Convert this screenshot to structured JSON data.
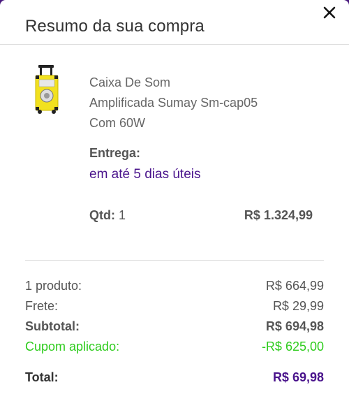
{
  "header": {
    "title": "Resumo da sua compra"
  },
  "product": {
    "name_line1": "Caixa De Som",
    "name_line2": "Amplificada Sumay Sm-cap05",
    "name_line3": "Com 60W",
    "image_icon": "yellow-speaker-trolley-image",
    "delivery_label": "Entrega:",
    "delivery_value": "em até 5 dias úteis",
    "qty_label": "Qtd:",
    "qty_value": "1",
    "price": "R$ 1.324,99"
  },
  "summary": {
    "products_label": "1 produto:",
    "products_value": "R$ 664,99",
    "shipping_label": "Frete:",
    "shipping_value": "R$ 29,99",
    "subtotal_label": "Subtotal:",
    "subtotal_value": "R$ 694,98",
    "coupon_label": "Cupom aplicado:",
    "coupon_value": "-R$ 625,00",
    "total_label": "Total:",
    "total_value": "R$ 69,98"
  },
  "colors": {
    "accent": "#4a148c",
    "coupon": "#2fcc1e",
    "product_yellow": "#f2e11f"
  }
}
